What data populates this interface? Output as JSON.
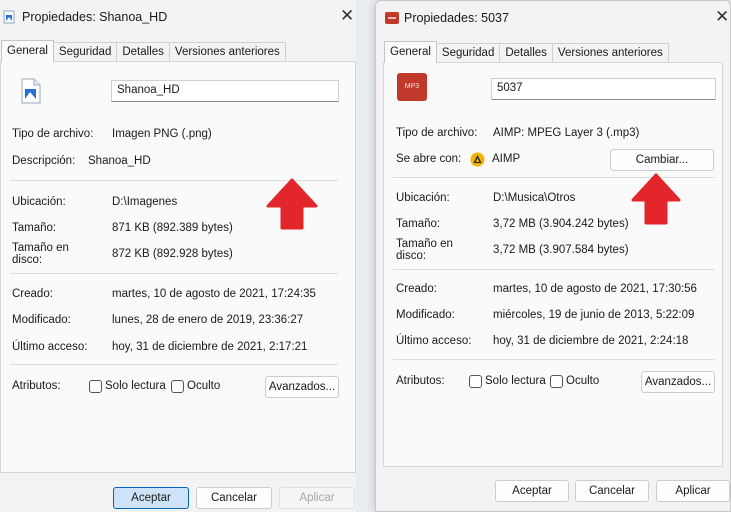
{
  "left_window": {
    "title": "Propiedades: Shanoa_HD",
    "close_glyph": "✕",
    "tabs": [
      "General",
      "Seguridad",
      "Detalles",
      "Versiones anteriores"
    ],
    "file_name": "Shanoa_HD",
    "file_type_label": "Tipo de archivo:",
    "file_type_value": "Imagen PNG (.png)",
    "description_label": "Descripción:",
    "description_value": "Shanoa_HD",
    "location_label": "Ubicación:",
    "location_value": "D:\\Imagenes",
    "size_label": "Tamaño:",
    "size_value": "871 KB (892.389 bytes)",
    "disk_size_label_1": "Tamaño en",
    "disk_size_label_2": "disco:",
    "disk_size_value": "872 KB (892.928 bytes)",
    "created_label": "Creado:",
    "created_value": "martes, 10 de agosto de 2021, 17:24:35",
    "modified_label": "Modificado:",
    "modified_value": "lunes, 28 de enero de 2019, 23:36:27",
    "accessed_label": "Último acceso:",
    "accessed_value": "hoy, 31 de diciembre de 2021, 2:17:21",
    "attributes_label": "Atributos:",
    "readonly_label": "Solo lectura",
    "hidden_label": "Oculto",
    "advanced_button": "Avanzados...",
    "ok_button": "Aceptar",
    "cancel_button": "Cancelar",
    "apply_button": "Aplicar"
  },
  "right_window": {
    "title": "Propiedades: 5037",
    "close_glyph": "✕",
    "tabs": [
      "General",
      "Seguridad",
      "Detalles",
      "Versiones anteriores"
    ],
    "file_icon_text": "MP3",
    "file_name": "5037",
    "file_type_label": "Tipo de archivo:",
    "file_type_value": "AIMP: MPEG Layer 3 (.mp3)",
    "opens_with_label": "Se abre con:",
    "opens_with_value": "AIMP",
    "change_button": "Cambiar...",
    "location_label": "Ubicación:",
    "location_value": "D:\\Musica\\Otros",
    "size_label": "Tamaño:",
    "size_value": "3,72 MB (3.904.242 bytes)",
    "disk_size_label_1": "Tamaño en",
    "disk_size_label_2": "disco:",
    "disk_size_value": "3,72 MB (3.907.584 bytes)",
    "created_label": "Creado:",
    "created_value": "martes, 10 de agosto de 2021, 17:30:56",
    "modified_label": "Modificado:",
    "modified_value": "miércoles, 19 de junio de 2013, 5:22:09",
    "accessed_label": "Último acceso:",
    "accessed_value": "hoy, 31 de diciembre de 2021, 2:24:18",
    "attributes_label": "Atributos:",
    "readonly_label": "Solo lectura",
    "hidden_label": "Oculto",
    "advanced_button": "Avanzados...",
    "ok_button": "Aceptar",
    "cancel_button": "Cancelar",
    "apply_button": "Aplicar"
  },
  "colors": {
    "annotation_arrow": "#e3262c",
    "mp3_icon": "#c0392b",
    "primary_button_border": "#0067c0",
    "aimp_icon": "#f0b400"
  }
}
